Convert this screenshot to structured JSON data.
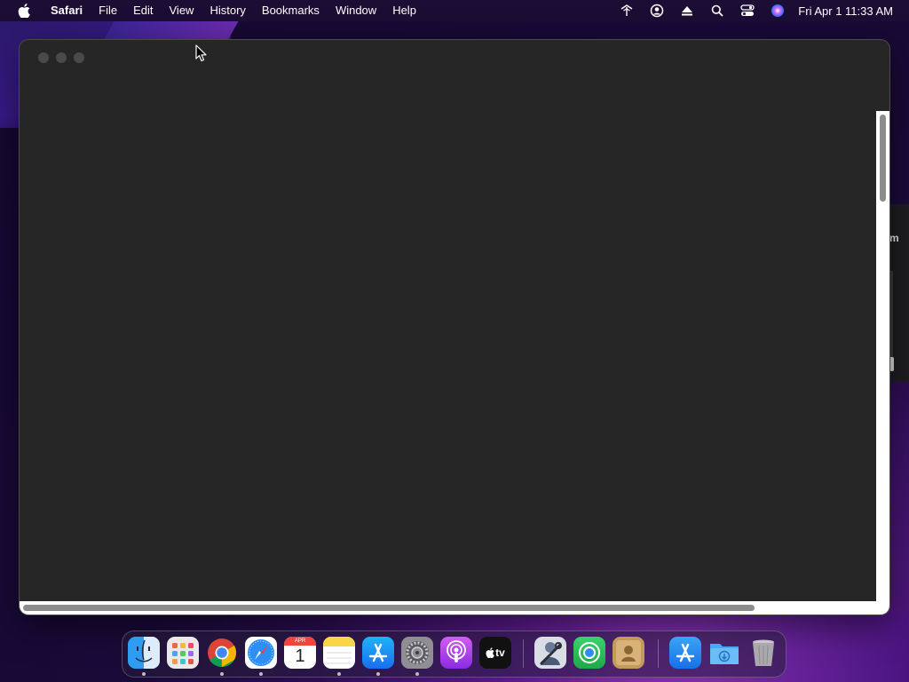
{
  "menubar": {
    "apple_icon": "apple-icon",
    "app_name": "Safari",
    "items": [
      "File",
      "Edit",
      "View",
      "History",
      "Bookmarks",
      "Window",
      "Help"
    ],
    "status_icons": [
      "network-icon",
      "user-icon",
      "eject-icon",
      "search-icon",
      "control-center-icon",
      "siri-icon"
    ],
    "clock": "Fri Apr 1  11:33 AM"
  },
  "window": {
    "app": "Safari",
    "state": "blank-loading",
    "background_color": "#262626"
  },
  "behind_window": {
    "visible_text": "m"
  },
  "dock": {
    "apps": [
      {
        "name": "Finder",
        "icon": "finder-icon",
        "running": true
      },
      {
        "name": "Launchpad",
        "icon": "launchpad-icon",
        "running": false
      },
      {
        "name": "Google Chrome",
        "icon": "chrome-icon",
        "running": true
      },
      {
        "name": "Safari",
        "icon": "safari-icon",
        "running": true
      },
      {
        "name": "Calendar",
        "icon": "calendar-icon",
        "running": false,
        "month": "APR",
        "day": "1"
      },
      {
        "name": "Notes",
        "icon": "notes-icon",
        "running": true
      },
      {
        "name": "App Store",
        "icon": "app-store-icon",
        "running": true
      },
      {
        "name": "System Preferences",
        "icon": "system-preferences-icon",
        "running": true
      },
      {
        "name": "Podcasts",
        "icon": "podcasts-icon",
        "running": false
      },
      {
        "name": "Apple TV",
        "icon": "apple-tv-icon",
        "running": false,
        "label": "tv"
      },
      {
        "name": "Directory Utility",
        "icon": "directory-utility-icon",
        "running": false
      },
      {
        "name": "Find My",
        "icon": "find-my-icon",
        "running": false
      },
      {
        "name": "Contacts",
        "icon": "contacts-icon",
        "running": false
      },
      {
        "name": "Applications",
        "icon": "applications-folder-icon",
        "running": false
      },
      {
        "name": "Downloads",
        "icon": "downloads-folder-icon",
        "running": false
      },
      {
        "name": "Trash",
        "icon": "trash-icon",
        "running": false
      }
    ]
  }
}
